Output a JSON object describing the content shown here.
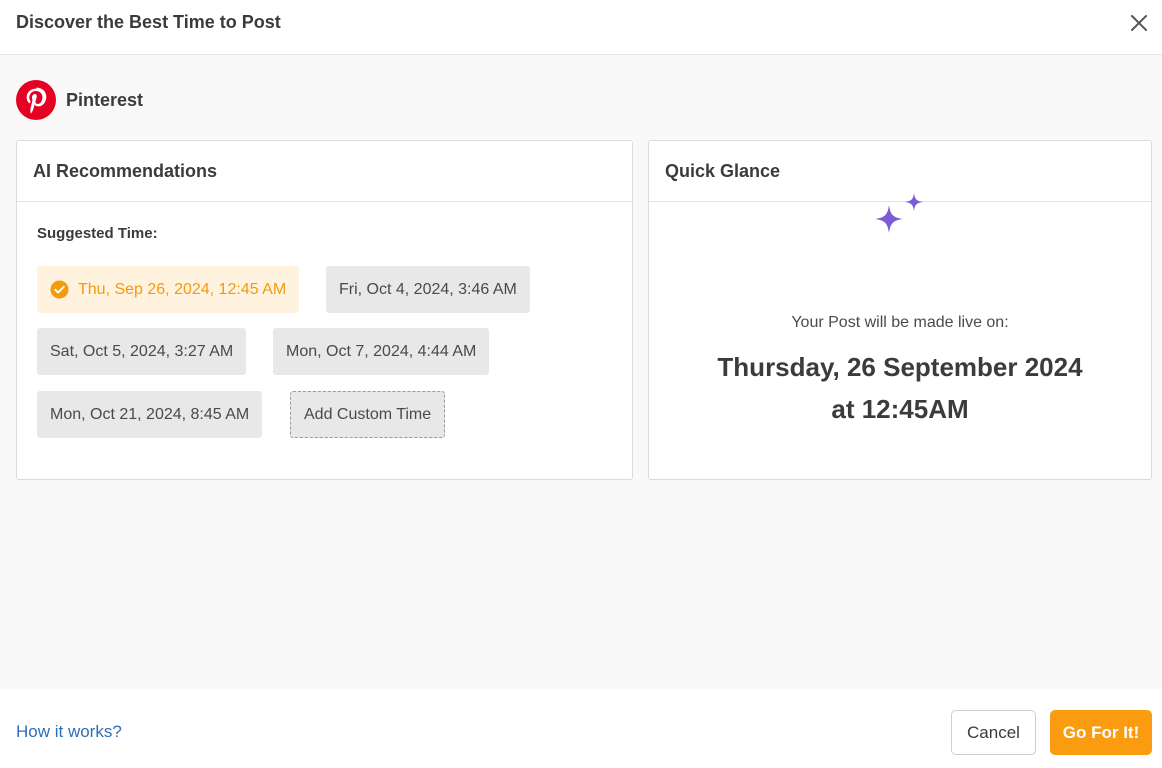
{
  "dialog": {
    "title": "Discover the Best Time to Post"
  },
  "platform": {
    "name": "Pinterest",
    "icon": "pinterest-logo-icon",
    "brand_color": "#e60023"
  },
  "recommendations": {
    "title": "AI Recommendations",
    "suggested_label": "Suggested Time:",
    "slots": [
      {
        "label": "Thu, Sep 26, 2024, 12:45 AM",
        "selected": true
      },
      {
        "label": "Fri, Oct 4, 2024, 3:46 AM",
        "selected": false
      },
      {
        "label": "Sat, Oct 5, 2024, 3:27 AM",
        "selected": false
      },
      {
        "label": "Mon, Oct 7, 2024, 4:44 AM",
        "selected": false
      },
      {
        "label": "Mon, Oct 21, 2024, 8:45 AM",
        "selected": false
      }
    ],
    "custom_label": "Add Custom Time",
    "selected_color": "#f29b0d"
  },
  "glance": {
    "title": "Quick Glance",
    "icon": "sparkle-icon",
    "icon_color": "#7c5cd6",
    "live_text": "Your Post will be made live on:",
    "live_date_line1": "Thursday, 26 September 2024",
    "live_date_line2": "at 12:45AM"
  },
  "footer": {
    "help_link": "How it works?",
    "cancel_label": "Cancel",
    "confirm_label": "Go For It!",
    "accent_color": "#fb9c10"
  }
}
